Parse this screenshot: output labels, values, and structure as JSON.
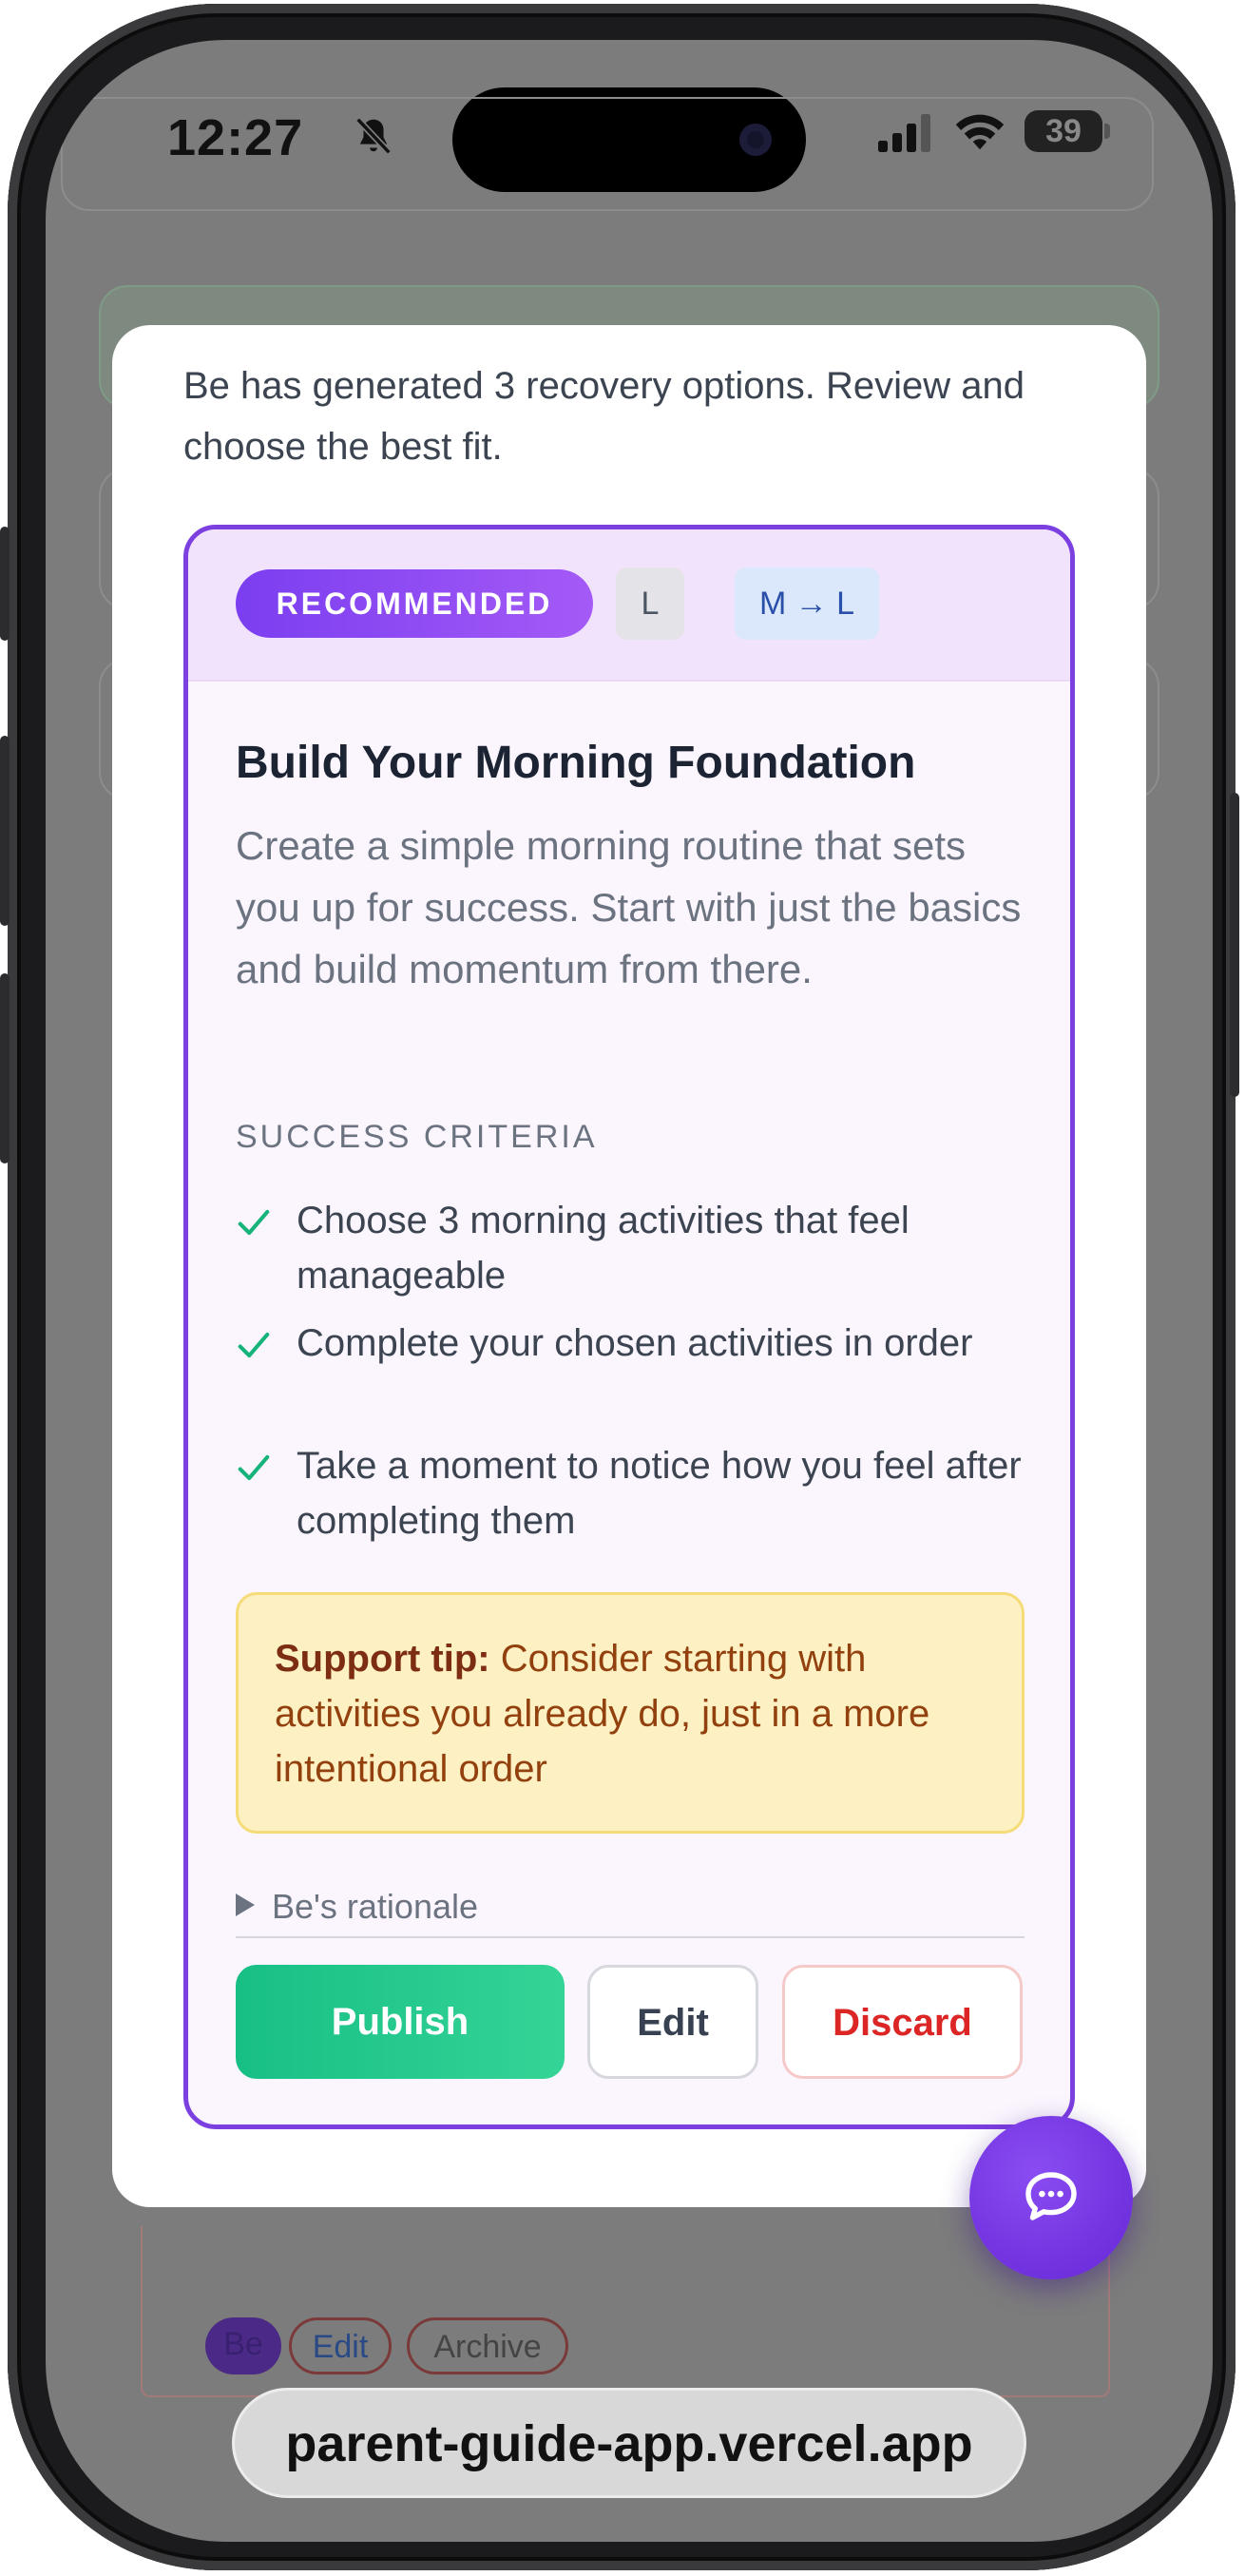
{
  "status_bar": {
    "time": "12:27",
    "battery": "39",
    "icons": [
      "bell-slash-icon",
      "signal-icon",
      "wifi-icon",
      "battery-icon"
    ]
  },
  "modal": {
    "intro": "Be has generated 3 recovery options. Review and choose the best fit.",
    "option": {
      "badge_recommended": "RECOMMENDED",
      "badge_size": "L",
      "badge_shift": "M → L",
      "title": "Build Your Morning Foundation",
      "description": "Create a simple morning routine that sets you up for success. Start with just the basics and build momentum from there.",
      "criteria_heading": "SUCCESS CRITERIA",
      "criteria": [
        "Choose 3 morning activities that feel manageable",
        "Complete your chosen activities in order",
        "Take a moment to notice how you feel after completing them"
      ],
      "tip_label": "Support tip:",
      "tip_text": " Consider starting with activities you already do, just in a more intentional order",
      "rationale_label": "Be's rationale",
      "publish_label": "Publish",
      "edit_label": "Edit",
      "discard_label": "Discard"
    }
  },
  "background": {
    "chip_be": "Be",
    "chip_edit": "Edit",
    "chip_archive": "Archive"
  },
  "browser": {
    "url": "parent-guide-app.vercel.app"
  },
  "colors": {
    "accent": "#7c3fe0",
    "publish": "#1fc98b",
    "discard": "#dc2626",
    "tip_bg": "#fdf0c2"
  }
}
